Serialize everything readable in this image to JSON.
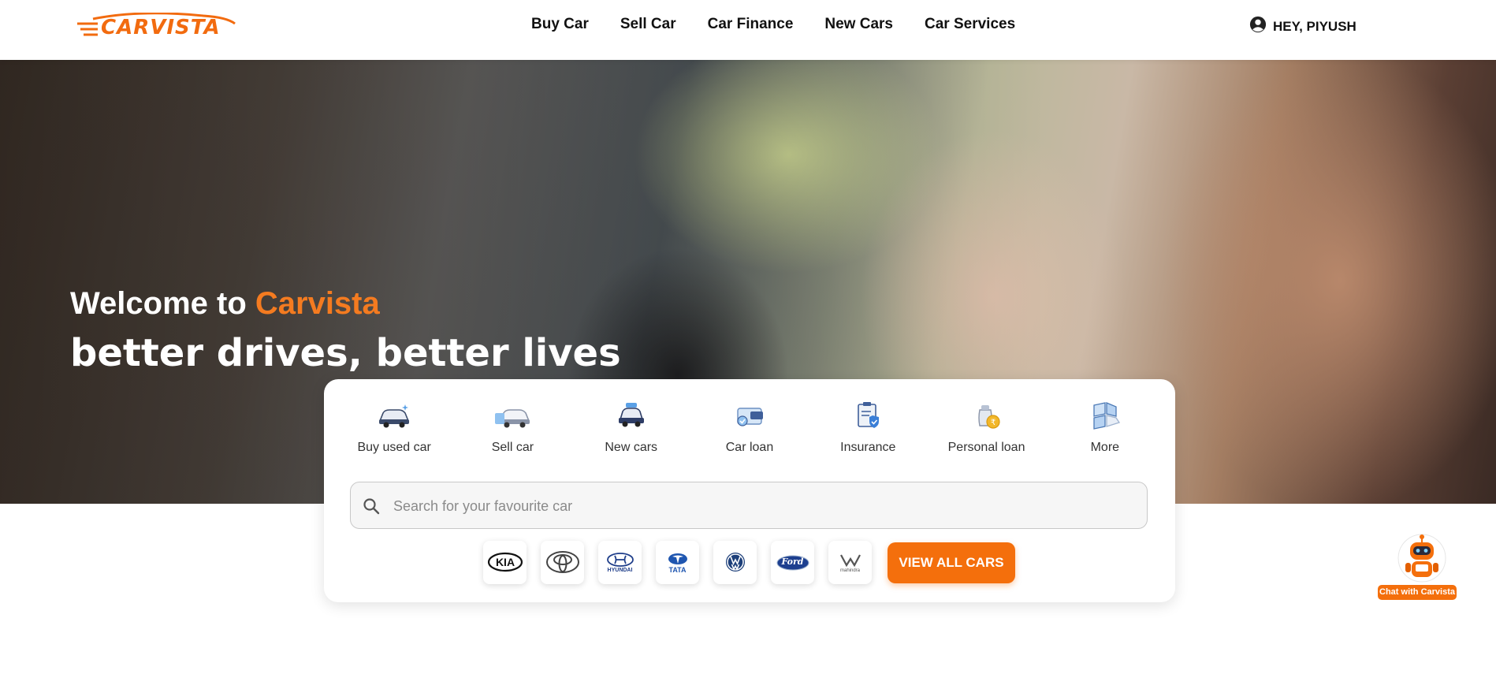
{
  "header": {
    "logo_text": "CARVISTA",
    "nav": [
      "Buy Car",
      "Sell Car",
      "Car Finance",
      "New Cars",
      "Car Services"
    ],
    "user_label": "HEY, PIYUSH"
  },
  "hero": {
    "welcome_prefix": "Welcome to ",
    "brand": "Carvista",
    "tagline": "better drives, better lives"
  },
  "services": [
    {
      "label": "Buy used car",
      "icon": "used-car-icon"
    },
    {
      "label": "Sell car",
      "icon": "sell-car-icon"
    },
    {
      "label": "New cars",
      "icon": "new-car-icon"
    },
    {
      "label": "Car loan",
      "icon": "car-loan-icon"
    },
    {
      "label": "Insurance",
      "icon": "insurance-icon"
    },
    {
      "label": "Personal loan",
      "icon": "personal-loan-icon"
    },
    {
      "label": "More",
      "icon": "more-grid-icon"
    }
  ],
  "search": {
    "placeholder": "Search for your favourite car",
    "value": ""
  },
  "brands": [
    "Kia",
    "Toyota",
    "Hyundai",
    "Tata",
    "Volkswagen",
    "Ford",
    "Mahindra"
  ],
  "brand_logo_text": {
    "hyundai": "HYUNDAI",
    "tata": "TATA",
    "ford": "Ford",
    "mahindra": "mahindra"
  },
  "view_all_label": "VIEW ALL CARS",
  "chatbot": {
    "label": "Chat with Carvista"
  },
  "colors": {
    "accent": "#f46f0c",
    "brand_orange": "#f47b20",
    "text": "#111111"
  }
}
